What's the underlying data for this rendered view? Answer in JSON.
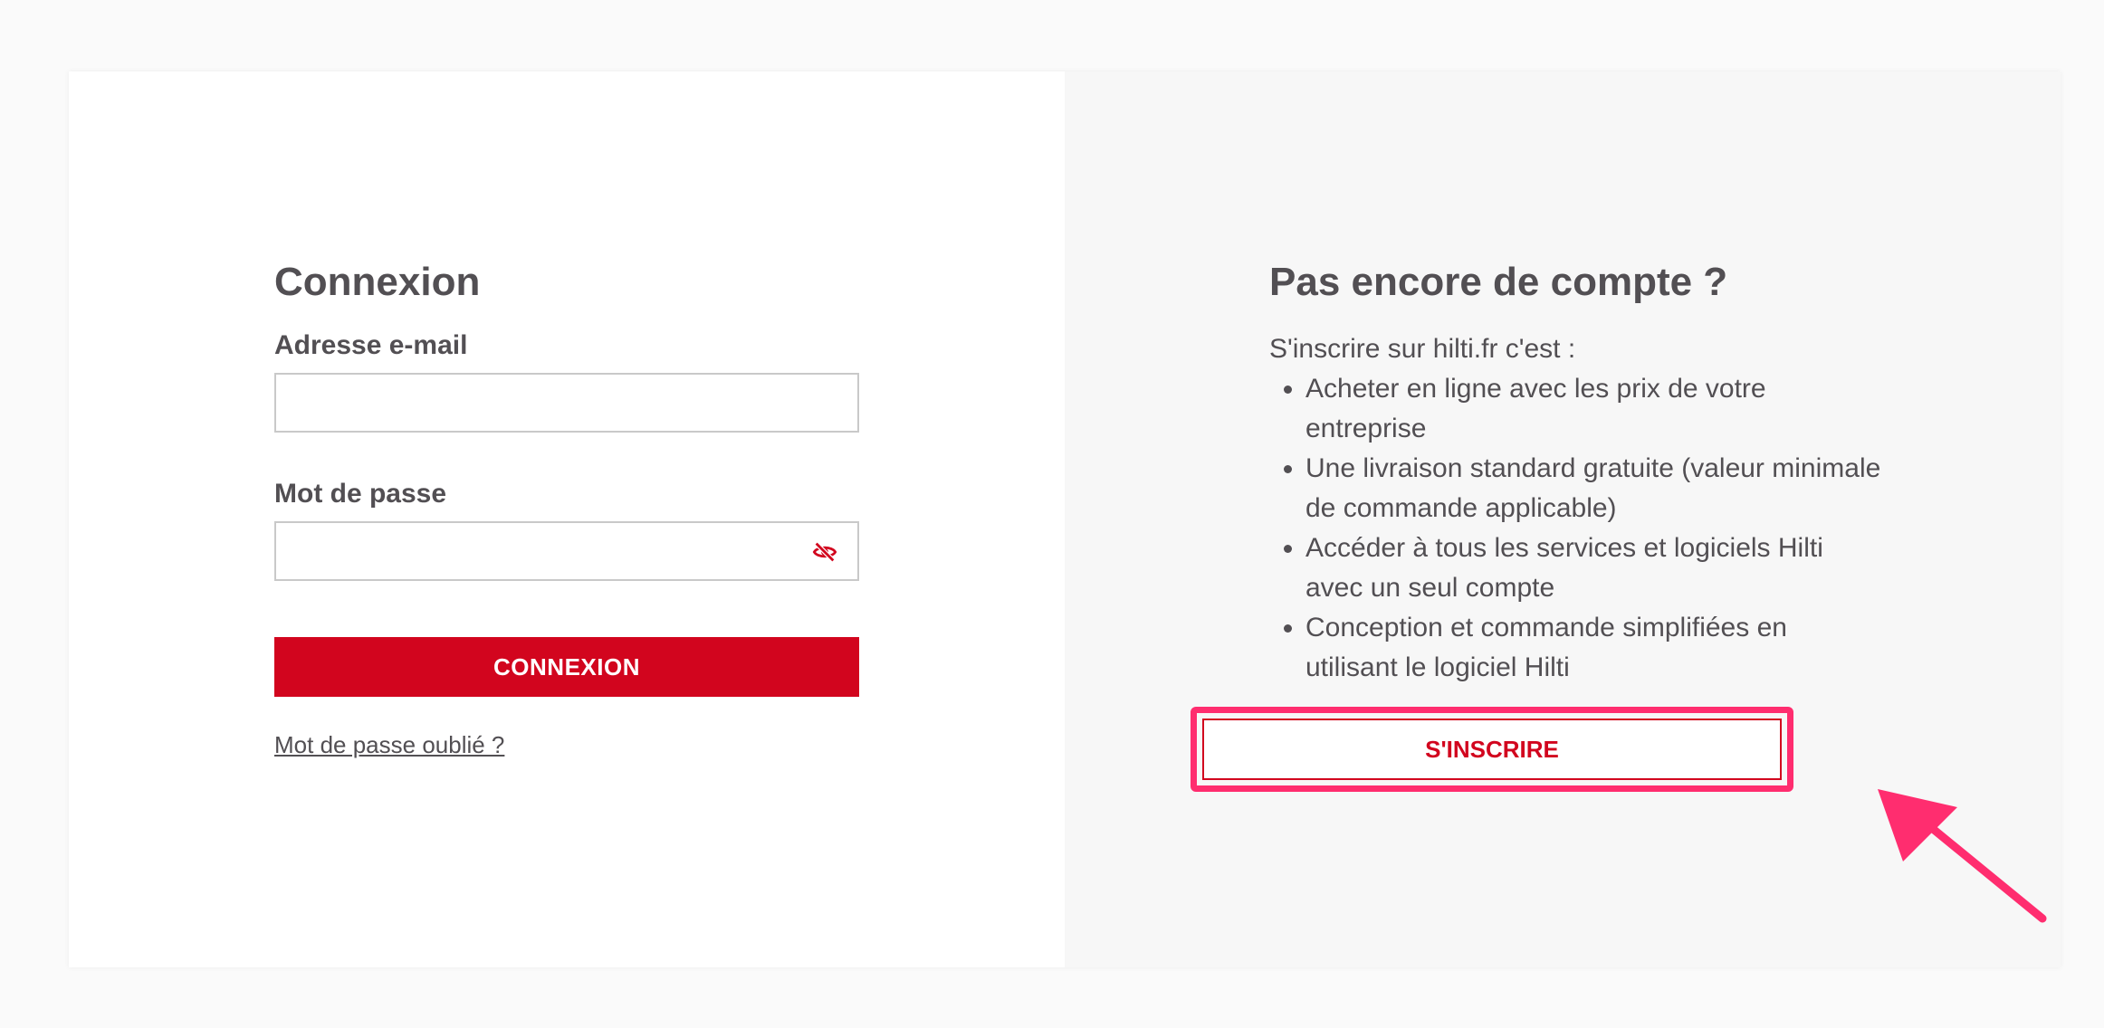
{
  "login": {
    "title": "Connexion",
    "email_label": "Adresse e-mail",
    "email_value": "",
    "password_label": "Mot de passe",
    "password_value": "",
    "toggle_password_icon": "eye-slash-icon",
    "submit_label": "CONNEXION",
    "forgot_label": "Mot de passe oublié ?"
  },
  "register": {
    "title": "Pas encore de compte ?",
    "intro": "S'inscrire sur hilti.fr c'est :",
    "benefits": [
      "Acheter en ligne avec les prix de votre entreprise",
      "Une livraison standard gratuite (valeur minimale de commande applicable)",
      "Accéder à tous les services et logiciels Hilti avec un seul compte",
      "Conception et commande simplifiées en utilisant le logiciel Hilti"
    ],
    "signup_label": "S'INSCRIRE"
  },
  "colors": {
    "brand_red": "#d2051e",
    "text": "#524f53",
    "annotation_pink": "#ff2d6f",
    "right_panel_bg": "#f7f7f7"
  }
}
